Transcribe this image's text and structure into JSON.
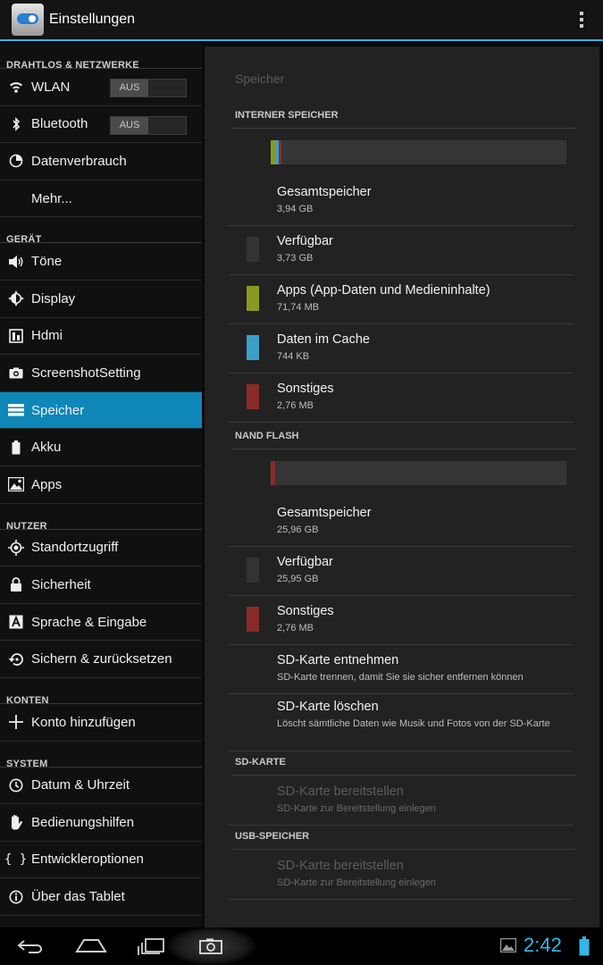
{
  "action_bar": {
    "title": "Einstellungen"
  },
  "sidebar": {
    "sections": [
      {
        "header": "DRAHTLOS & NETZWERKE",
        "items": [
          {
            "label": "WLAN",
            "icon": "wifi-icon",
            "toggle": "AUS"
          },
          {
            "label": "Bluetooth",
            "icon": "bluetooth-icon",
            "toggle": "AUS"
          },
          {
            "label": "Datenverbrauch",
            "icon": "data-usage-icon"
          },
          {
            "label": "Mehr...",
            "icon": ""
          }
        ]
      },
      {
        "header": "GERÄT",
        "items": [
          {
            "label": "Töne",
            "icon": "speaker-icon"
          },
          {
            "label": "Display",
            "icon": "brightness-icon"
          },
          {
            "label": "Hdmi",
            "icon": "hdmi-icon"
          },
          {
            "label": "ScreenshotSetting",
            "icon": "camera-icon"
          },
          {
            "label": "Speicher",
            "icon": "storage-icon",
            "selected": true
          },
          {
            "label": "Akku",
            "icon": "battery-icon"
          },
          {
            "label": "Apps",
            "icon": "apps-icon"
          }
        ]
      },
      {
        "header": "NUTZER",
        "items": [
          {
            "label": "Standortzugriff",
            "icon": "location-icon"
          },
          {
            "label": "Sicherheit",
            "icon": "lock-icon"
          },
          {
            "label": "Sprache & Eingabe",
            "icon": "language-icon"
          },
          {
            "label": "Sichern & zurücksetzen",
            "icon": "backup-icon"
          }
        ]
      },
      {
        "header": "KONTEN",
        "items": [
          {
            "label": "Konto hinzufügen",
            "icon": "plus-icon"
          }
        ]
      },
      {
        "header": "SYSTEM",
        "items": [
          {
            "label": "Datum & Uhrzeit",
            "icon": "clock-icon"
          },
          {
            "label": "Bedienungshilfen",
            "icon": "hand-icon"
          },
          {
            "label": "Entwickleroptionen",
            "icon": "braces-icon"
          },
          {
            "label": "Über das Tablet",
            "icon": "info-icon"
          }
        ]
      }
    ]
  },
  "storage": {
    "title": "Speicher",
    "internal": {
      "header": "INTERNER SPEICHER",
      "rows": [
        {
          "title": "Gesamtspeicher",
          "value": "3,94 GB"
        },
        {
          "title": "Verfügbar",
          "value": "3,73 GB",
          "color": "#333333"
        },
        {
          "title": "Apps (App-Daten und Medieninhalte)",
          "value": "71,74 MB",
          "color": "#8a9a1e"
        },
        {
          "title": "Daten im Cache",
          "value": "744 KB",
          "color": "#3aa0c8"
        },
        {
          "title": "Sonstiges",
          "value": "2,76 MB",
          "color": "#8a2a2a"
        }
      ]
    },
    "nand": {
      "header": "NAND FLASH",
      "rows": [
        {
          "title": "Gesamtspeicher",
          "value": "25,96 GB"
        },
        {
          "title": "Verfügbar",
          "value": "25,95 GB",
          "color": "#333333"
        },
        {
          "title": "Sonstiges",
          "value": "2,76 MB",
          "color": "#8a2a2a"
        }
      ],
      "eject": {
        "title": "SD-Karte entnehmen",
        "summary": "SD-Karte trennen, damit Sie sie sicher entfernen können"
      },
      "erase": {
        "title": "SD-Karte löschen",
        "summary": "Löscht sämtliche Daten wie Musik und Fotos von der SD-Karte"
      }
    },
    "sdcard": {
      "header": "SD-KARTE",
      "mount": {
        "title": "SD-Karte bereitstellen",
        "summary": "SD-Karte zur Bereitstellung einlegen"
      }
    },
    "usb": {
      "header": "USB-SPEICHER",
      "mount": {
        "title": "SD-Karte bereitstellen",
        "summary": "SD-Karte zur Bereitstellung einlegen"
      }
    }
  },
  "status_bar": {
    "time": "2:42"
  },
  "colors": {
    "accent": "#33b5e5",
    "selected": "#0e86b8"
  }
}
